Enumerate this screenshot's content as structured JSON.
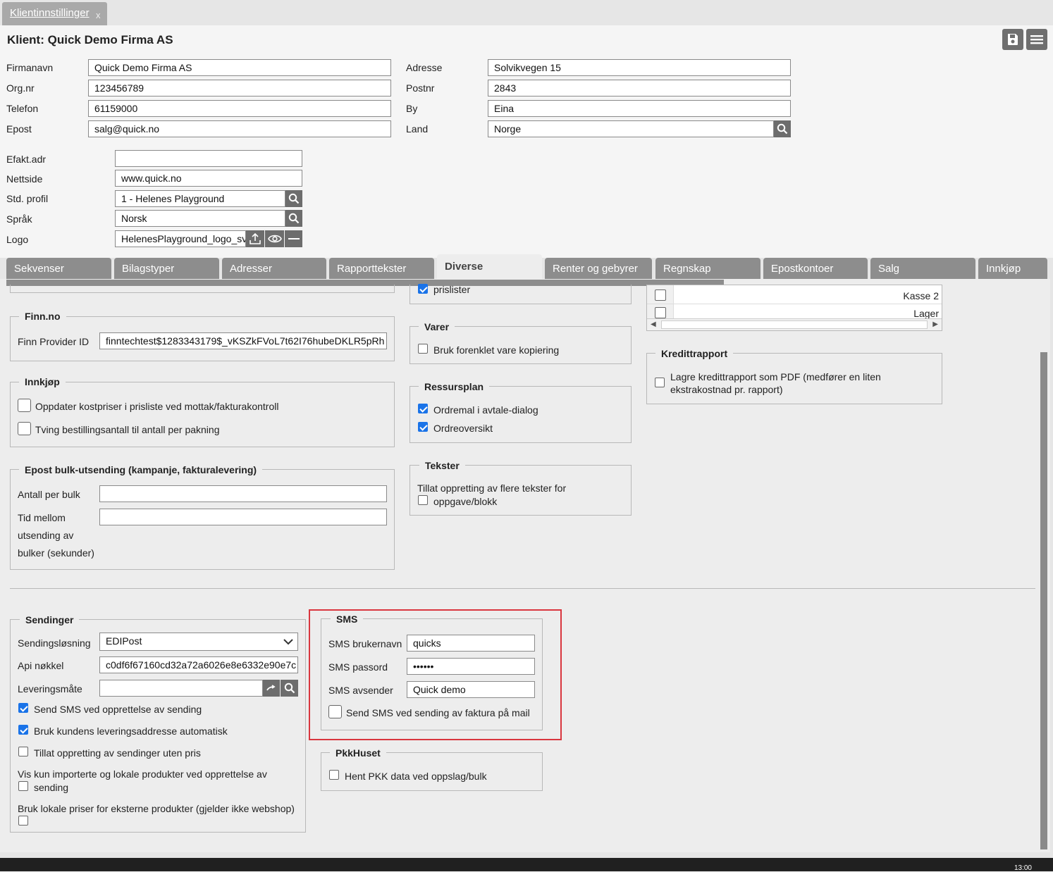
{
  "window": {
    "tab_title": "Klientinnstillinger",
    "tab_close": "x"
  },
  "header": {
    "title": "Klient: Quick Demo Firma AS",
    "save_icon": "floppy-disk-icon",
    "menu_icon": "hamburger-menu-icon"
  },
  "form": {
    "firmanavn_label": "Firmanavn",
    "firmanavn_value": "Quick Demo Firma AS",
    "orgnr_label": "Org.nr",
    "orgnr_value": "123456789",
    "telefon_label": "Telefon",
    "telefon_value": "61159000",
    "epost_label": "Epost",
    "epost_value": "salg@quick.no",
    "adresse_label": "Adresse",
    "adresse_value": "Solvikvegen 15",
    "postnr_label": "Postnr",
    "postnr_value": "2843",
    "by_label": "By",
    "by_value": "Eina",
    "land_label": "Land",
    "land_value": "Norge",
    "efakt_label": "Efakt.adr",
    "efakt_value": "",
    "nettside_label": "Nettside",
    "nettside_value": "www.quick.no",
    "profil_label": "Std. profil",
    "profil_value": "1 - Helenes Playground",
    "sprak_label": "Språk",
    "sprak_value": "Norsk",
    "logo_label": "Logo",
    "logo_value": "HelenesPlayground_logo_sv"
  },
  "tabs": [
    "Sekvenser",
    "Bilagstyper",
    "Adresser",
    "Rapporttekster",
    "Diverse",
    "Renter og gebyrer",
    "Regnskap",
    "Epostkontoer",
    "Salg",
    "Innkjøp"
  ],
  "active_tab": "Diverse",
  "finn": {
    "legend": "Finn.no",
    "provider_label": "Finn Provider ID",
    "provider_value": "finntechtest$1283343179$_vKSZkFVoL7t62I76hubeDKLR5pRh"
  },
  "innkjop": {
    "legend": "Innkjøp",
    "opt1": "Oppdater kostpriser i prisliste ved mottak/fakturakontroll",
    "opt2": "Tving bestillingsantall til antall per pakning"
  },
  "epost_bulk": {
    "legend": "Epost bulk-utsending (kampanje, fakturalevering)",
    "antall_label": "Antall per bulk",
    "tid_line1": "Tid mellom",
    "tid_line2": "utsending av",
    "tid_line3": "bulker (sekunder)"
  },
  "prislister": {
    "label": "prislister"
  },
  "varer": {
    "legend": "Varer",
    "opt1": "Bruk forenklet vare kopiering"
  },
  "ressursplan": {
    "legend": "Ressursplan",
    "opt1": "Ordremal i avtale-dialog",
    "opt2": "Ordreoversikt"
  },
  "tekster": {
    "legend": "Tekster",
    "opt_line1": "Tillat oppretting av flere tekster for",
    "opt_line2": "oppgave/blokk"
  },
  "kasse_list": {
    "row1": "Kasse 2",
    "row2": "Lager"
  },
  "kredittrapport": {
    "legend": "Kredittrapport",
    "opt_line1": "Lagre kredittrapport som PDF (medfører en liten",
    "opt_line2": "ekstrakostnad pr. rapport)"
  },
  "sendinger": {
    "legend": "Sendinger",
    "losning_label": "Sendingsløsning",
    "losning_value": "EDIPost",
    "api_label": "Api nøkkel",
    "api_value": "c0df6f67160cd32a72a6026e8e6332e90e7c",
    "leveringsmate_label": "Leveringsmåte",
    "leveringsmate_value": "",
    "opt1": "Send SMS ved opprettelse av sending",
    "opt2": "Bruk kundens leveringsaddresse automatisk",
    "opt3": "Tillat oppretting av sendinger uten pris",
    "opt4_line1": "Vis kun importerte og lokale produkter ved opprettelse av",
    "opt4_line2": "sending",
    "opt5": "Bruk lokale priser for eksterne produkter (gjelder ikke webshop)"
  },
  "sms": {
    "legend": "SMS",
    "brukernavn_label": "SMS brukernavn",
    "brukernavn_value": "quicks",
    "passord_label": "SMS passord",
    "passord_value": "••••••",
    "avsender_label": "SMS avsender",
    "avsender_value": "Quick demo",
    "opt1": "Send SMS ved sending av faktura på mail",
    "highlight_color": "#d9363e"
  },
  "pkk": {
    "legend": "PkkHuset",
    "opt1": "Hent PKK data ved oppslag/bulk"
  },
  "taskbar": {
    "clock": "13:00"
  }
}
